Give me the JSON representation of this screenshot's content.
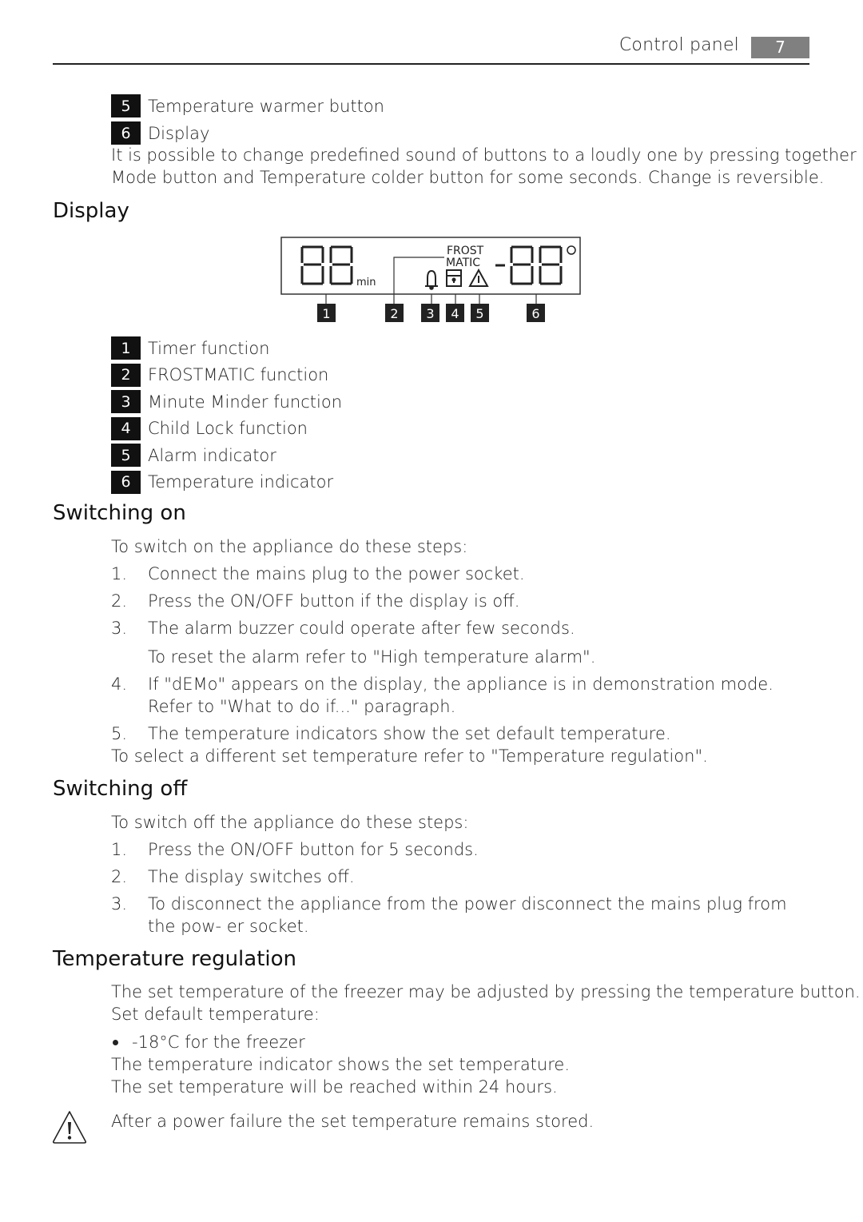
{
  "header": {
    "section_title": "Control panel",
    "page_number": "7"
  },
  "intro_items": [
    {
      "num": "5",
      "label": "Temperature warmer button"
    },
    {
      "num": "6",
      "label": "Display"
    }
  ],
  "intro_paragraph": [
    "It is possible to change predefined sound of buttons to a loudly one by pressing together",
    "Mode button and Temperature colder button for some seconds. Change is reversible."
  ],
  "display_section": {
    "heading": "Display",
    "lcd": {
      "timer_digits": "88",
      "timer_unit": "min",
      "frostmatic_line1": "FROST",
      "frostmatic_line2": "MATIC",
      "temp_digits": "-88",
      "degree_symbol": "°",
      "icons": [
        "bell-icon",
        "child-lock-icon",
        "alarm-warning-icon"
      ],
      "callouts": [
        "1",
        "2",
        "3",
        "4",
        "5",
        "6"
      ]
    },
    "legend": [
      {
        "num": "1",
        "label": "Timer function"
      },
      {
        "num": "2",
        "label": "FROSTMATIC function"
      },
      {
        "num": "3",
        "label": "Minute Minder function"
      },
      {
        "num": "4",
        "label": "Child Lock function"
      },
      {
        "num": "5",
        "label": "Alarm indicator"
      },
      {
        "num": "6",
        "label": "Temperature indicator"
      }
    ]
  },
  "switching_on": {
    "heading": "Switching on",
    "intro": "To switch on the appliance do these steps:",
    "steps": [
      {
        "num": "1.",
        "text": "Connect the mains plug to the power socket."
      },
      {
        "num": "2.",
        "text": "Press the ON/OFF button if the display is off."
      },
      {
        "num": "3.",
        "text": "The alarm buzzer could operate after few seconds."
      },
      {
        "num": "",
        "text": "To reset the alarm refer to \"High temperature alarm\"."
      },
      {
        "num": "4.",
        "text": "If \"dEMo\" appears on the display, the appliance is in demonstration mode. Refer to \"What to do if...\" paragraph."
      },
      {
        "num": "5.",
        "text": "The temperature indicators show the set default temperature."
      }
    ],
    "outro": "To select a different set temperature refer to \"Temperature regulation\"."
  },
  "switching_off": {
    "heading": "Switching off",
    "intro": "To switch off the appliance do these steps:",
    "steps": [
      {
        "num": "1.",
        "text": "Press the ON/OFF button for 5 seconds."
      },
      {
        "num": "2.",
        "text": "The display switches off."
      },
      {
        "num": "3.",
        "text": "To disconnect the appliance from the power disconnect the mains plug from the pow- er socket."
      }
    ]
  },
  "temperature_regulation": {
    "heading": "Temperature regulation",
    "paragraph1": "The set temperature of the freezer may be adjusted by pressing the temperature button.",
    "paragraph2": "Set default temperature:",
    "bullet": "-18°C for the freezer",
    "paragraph3": "The temperature indicator shows the set temperature.",
    "paragraph4": "The set temperature will be reached within 24 hours.",
    "warning_icon": "warning-triangle-icon",
    "warning_text": "After a power failure the set temperature remains stored."
  }
}
